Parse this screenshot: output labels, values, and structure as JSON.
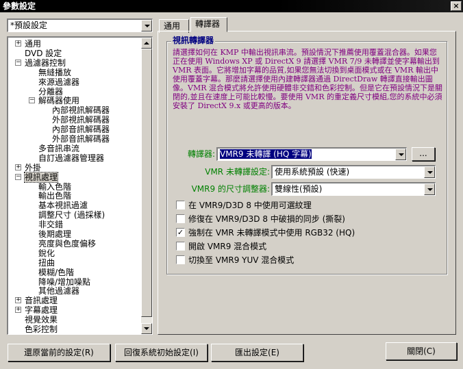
{
  "window": {
    "title": "參數設定",
    "close_glyph": "×"
  },
  "preset": {
    "value": "*預設設定"
  },
  "tree": {
    "items": [
      {
        "label": "通用",
        "exp": "+"
      },
      {
        "label": "DVD 設定",
        "exp": ""
      },
      {
        "label": "過濾器控制",
        "exp": "−"
      },
      {
        "label": "無縫播放",
        "exp": ""
      },
      {
        "label": "來源過濾器",
        "exp": ""
      },
      {
        "label": "分離器",
        "exp": ""
      },
      {
        "label": "解碼器使用",
        "exp": "−"
      },
      {
        "label": "內部視訊解碼器",
        "exp": ""
      },
      {
        "label": "外部視訊解碼器",
        "exp": ""
      },
      {
        "label": "內部音訊解碼器",
        "exp": ""
      },
      {
        "label": "外部音訊解碼器",
        "exp": ""
      },
      {
        "label": "多音訊串流",
        "exp": ""
      },
      {
        "label": "自訂過濾器管理器",
        "exp": ""
      },
      {
        "label": "外掛",
        "exp": "+"
      },
      {
        "label": "視訊處理",
        "exp": "−"
      },
      {
        "label": "輸入色階",
        "exp": ""
      },
      {
        "label": "輸出色階",
        "exp": ""
      },
      {
        "label": "基本視訊過濾",
        "exp": ""
      },
      {
        "label": "調整尺寸 (過採樣)",
        "exp": ""
      },
      {
        "label": "非交錯",
        "exp": ""
      },
      {
        "label": "後期處理",
        "exp": ""
      },
      {
        "label": "亮度與色度偏移",
        "exp": ""
      },
      {
        "label": "銳化",
        "exp": ""
      },
      {
        "label": "扭曲",
        "exp": ""
      },
      {
        "label": "模糊/色階",
        "exp": ""
      },
      {
        "label": "降噪/增加噪點",
        "exp": ""
      },
      {
        "label": "其他過濾器",
        "exp": ""
      },
      {
        "label": "音訊處理",
        "exp": "+"
      },
      {
        "label": "字幕處理",
        "exp": "+"
      },
      {
        "label": "視覺效果",
        "exp": ""
      },
      {
        "label": "色彩控制",
        "exp": ""
      }
    ]
  },
  "tabs": [
    {
      "label": "通用"
    },
    {
      "label": "轉譯器"
    }
  ],
  "group": {
    "title": "視訊轉譯器",
    "description": "請選擇如何在 KMP 中輸出視訊串流。預設情況下推薦使用覆蓋混合器。如果您正在使用 Windows XP 或 DirectX 9 請選擇 VMR 7/9 未轉譯並使字幕輸出到 VMR 表面。它將增加字幕的品質,如果您無法切換到桌面模式或在 VMR 輸出中使用覆蓋字幕。那麼請選擇使用內建轉譯器通過 DirectDraw 轉譯直接輸出圖像。VMR 混合模式將允許使用硬體非交錯和色彩控制。但是它在預設情況下是關閉的,並且在速度上可能比較慢。要使用 VMR 的重定義尺寸模組,您的系統中必須安裝了 DirectX 9.x 或更高的版本。"
  },
  "renderer": {
    "label": "轉譯器:",
    "value": "VMR9 未轉譯 (HQ 字幕)",
    "more": "..."
  },
  "vmr_setting": {
    "label": "VMR 未轉譯設定:",
    "value": "使用系統預設 (快速)"
  },
  "resizer": {
    "label": "VMR9 的尺寸調整器:",
    "value": "雙線性(預設)"
  },
  "checkboxes": [
    {
      "label": "在 VMR9/D3D 8 中使用可選紋理",
      "checked": ""
    },
    {
      "label": "修復在 VMR9/D3D 8 中破損的同步 (撕裂)",
      "checked": ""
    },
    {
      "label": "強制在 VMR 未轉譯模式中使用 RGB32 (HQ)",
      "checked": "✓"
    },
    {
      "label": "開啟 VMR9 混合模式",
      "checked": ""
    },
    {
      "label": "切換至 VMR9 YUV 混合模式",
      "checked": ""
    }
  ],
  "buttons": {
    "restore": "還原當前的設定(R)",
    "reset": "回復系統初始設定(I)",
    "export": "匯出設定(E)",
    "close": "關閉(C)"
  },
  "colors": {
    "accent": "#000080",
    "description": "#800080",
    "green_label": "#008000",
    "face": "#d4d0c8"
  }
}
